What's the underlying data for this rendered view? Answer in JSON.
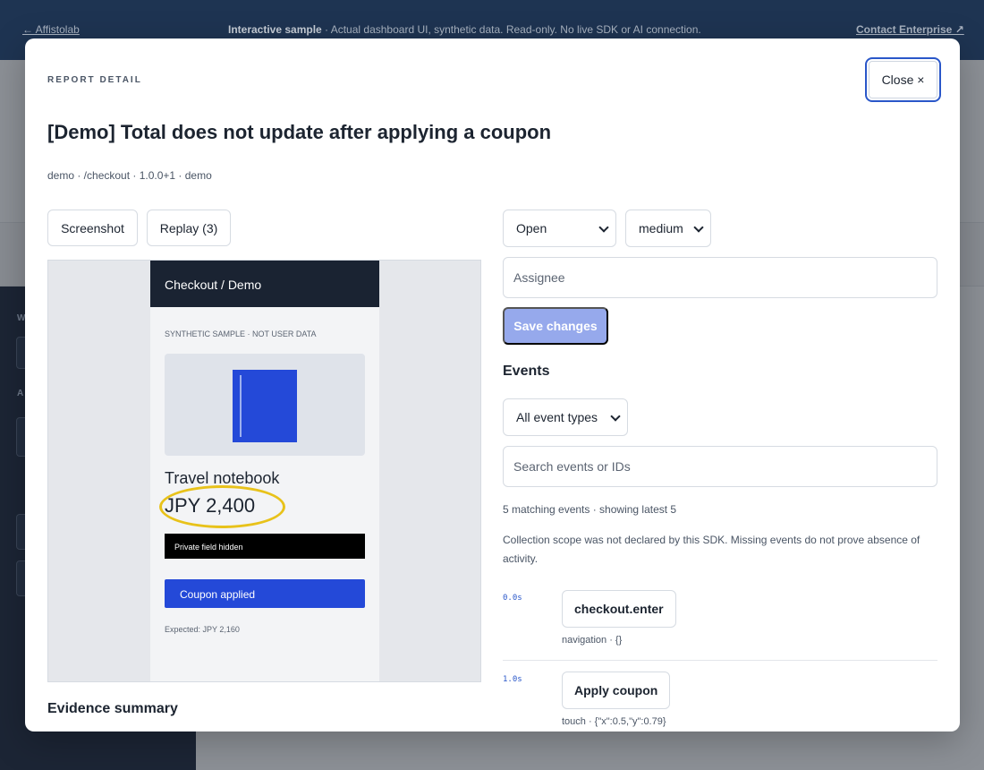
{
  "topbar": {
    "back_link": "← Affistolab",
    "sample_bold": "Interactive sample",
    "sample_rest": " · Actual dashboard UI, synthetic data. Read-only. No live SDK or AI connection.",
    "contact_link": "Contact Enterprise ↗"
  },
  "modal": {
    "eyebrow": "REPORT DETAIL",
    "close_label": "Close ×",
    "title": "[Demo] Total does not update after applying a coupon",
    "meta": "demo · /checkout · 1.0.0+1 · demo",
    "tabs": {
      "screenshot": "Screenshot",
      "replay": "Replay (3)"
    },
    "preview": {
      "header": "Checkout / Demo",
      "note": "SYNTHETIC SAMPLE · NOT USER DATA",
      "product_name": "Travel notebook",
      "price": "JPY 2,400",
      "redacted": "Private field hidden",
      "coupon_button": "Coupon applied",
      "expected": "Expected: JPY 2,160"
    },
    "evidence_heading": "Evidence summary",
    "status_select": "Open",
    "severity_select": "medium",
    "assignee_placeholder": "Assignee",
    "save_button": "Save changes",
    "events": {
      "heading": "Events",
      "filter_select": "All event types",
      "search_placeholder": "Search events or IDs",
      "count_line": "5 matching events · showing latest 5",
      "scope_note": "Collection scope was not declared by this SDK. Missing events do not prove absence of activity.",
      "items": [
        {
          "time": "0.0s",
          "name": "checkout.enter",
          "meta": "navigation · {}"
        },
        {
          "time": "1.0s",
          "name": "Apply coupon",
          "meta": "touch · {\"x\":0.5,\"y\":0.79}"
        }
      ]
    }
  }
}
